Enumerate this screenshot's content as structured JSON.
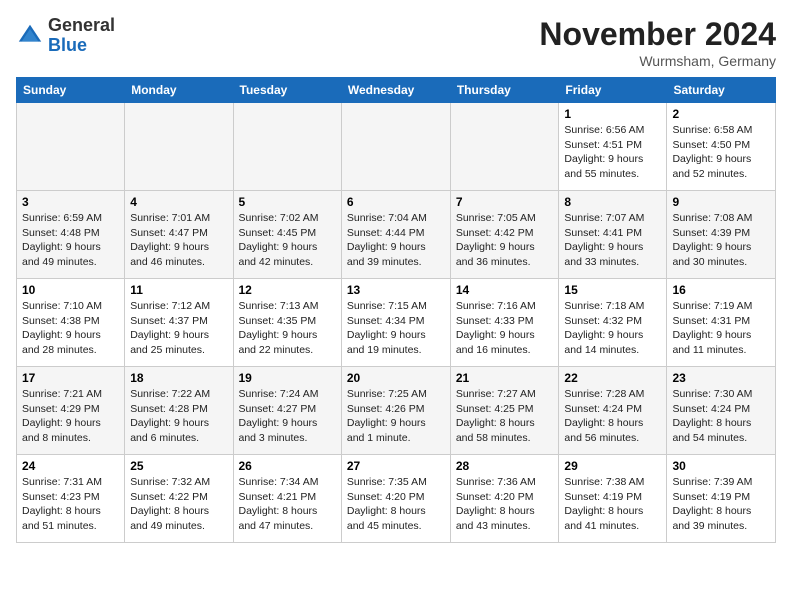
{
  "header": {
    "logo_general": "General",
    "logo_blue": "Blue",
    "month_title": "November 2024",
    "location": "Wurmsham, Germany"
  },
  "weekdays": [
    "Sunday",
    "Monday",
    "Tuesday",
    "Wednesday",
    "Thursday",
    "Friday",
    "Saturday"
  ],
  "weeks": [
    [
      {
        "day": "",
        "info": ""
      },
      {
        "day": "",
        "info": ""
      },
      {
        "day": "",
        "info": ""
      },
      {
        "day": "",
        "info": ""
      },
      {
        "day": "",
        "info": ""
      },
      {
        "day": "1",
        "info": "Sunrise: 6:56 AM\nSunset: 4:51 PM\nDaylight: 9 hours\nand 55 minutes."
      },
      {
        "day": "2",
        "info": "Sunrise: 6:58 AM\nSunset: 4:50 PM\nDaylight: 9 hours\nand 52 minutes."
      }
    ],
    [
      {
        "day": "3",
        "info": "Sunrise: 6:59 AM\nSunset: 4:48 PM\nDaylight: 9 hours\nand 49 minutes."
      },
      {
        "day": "4",
        "info": "Sunrise: 7:01 AM\nSunset: 4:47 PM\nDaylight: 9 hours\nand 46 minutes."
      },
      {
        "day": "5",
        "info": "Sunrise: 7:02 AM\nSunset: 4:45 PM\nDaylight: 9 hours\nand 42 minutes."
      },
      {
        "day": "6",
        "info": "Sunrise: 7:04 AM\nSunset: 4:44 PM\nDaylight: 9 hours\nand 39 minutes."
      },
      {
        "day": "7",
        "info": "Sunrise: 7:05 AM\nSunset: 4:42 PM\nDaylight: 9 hours\nand 36 minutes."
      },
      {
        "day": "8",
        "info": "Sunrise: 7:07 AM\nSunset: 4:41 PM\nDaylight: 9 hours\nand 33 minutes."
      },
      {
        "day": "9",
        "info": "Sunrise: 7:08 AM\nSunset: 4:39 PM\nDaylight: 9 hours\nand 30 minutes."
      }
    ],
    [
      {
        "day": "10",
        "info": "Sunrise: 7:10 AM\nSunset: 4:38 PM\nDaylight: 9 hours\nand 28 minutes."
      },
      {
        "day": "11",
        "info": "Sunrise: 7:12 AM\nSunset: 4:37 PM\nDaylight: 9 hours\nand 25 minutes."
      },
      {
        "day": "12",
        "info": "Sunrise: 7:13 AM\nSunset: 4:35 PM\nDaylight: 9 hours\nand 22 minutes."
      },
      {
        "day": "13",
        "info": "Sunrise: 7:15 AM\nSunset: 4:34 PM\nDaylight: 9 hours\nand 19 minutes."
      },
      {
        "day": "14",
        "info": "Sunrise: 7:16 AM\nSunset: 4:33 PM\nDaylight: 9 hours\nand 16 minutes."
      },
      {
        "day": "15",
        "info": "Sunrise: 7:18 AM\nSunset: 4:32 PM\nDaylight: 9 hours\nand 14 minutes."
      },
      {
        "day": "16",
        "info": "Sunrise: 7:19 AM\nSunset: 4:31 PM\nDaylight: 9 hours\nand 11 minutes."
      }
    ],
    [
      {
        "day": "17",
        "info": "Sunrise: 7:21 AM\nSunset: 4:29 PM\nDaylight: 9 hours\nand 8 minutes."
      },
      {
        "day": "18",
        "info": "Sunrise: 7:22 AM\nSunset: 4:28 PM\nDaylight: 9 hours\nand 6 minutes."
      },
      {
        "day": "19",
        "info": "Sunrise: 7:24 AM\nSunset: 4:27 PM\nDaylight: 9 hours\nand 3 minutes."
      },
      {
        "day": "20",
        "info": "Sunrise: 7:25 AM\nSunset: 4:26 PM\nDaylight: 9 hours\nand 1 minute."
      },
      {
        "day": "21",
        "info": "Sunrise: 7:27 AM\nSunset: 4:25 PM\nDaylight: 8 hours\nand 58 minutes."
      },
      {
        "day": "22",
        "info": "Sunrise: 7:28 AM\nSunset: 4:24 PM\nDaylight: 8 hours\nand 56 minutes."
      },
      {
        "day": "23",
        "info": "Sunrise: 7:30 AM\nSunset: 4:24 PM\nDaylight: 8 hours\nand 54 minutes."
      }
    ],
    [
      {
        "day": "24",
        "info": "Sunrise: 7:31 AM\nSunset: 4:23 PM\nDaylight: 8 hours\nand 51 minutes."
      },
      {
        "day": "25",
        "info": "Sunrise: 7:32 AM\nSunset: 4:22 PM\nDaylight: 8 hours\nand 49 minutes."
      },
      {
        "day": "26",
        "info": "Sunrise: 7:34 AM\nSunset: 4:21 PM\nDaylight: 8 hours\nand 47 minutes."
      },
      {
        "day": "27",
        "info": "Sunrise: 7:35 AM\nSunset: 4:20 PM\nDaylight: 8 hours\nand 45 minutes."
      },
      {
        "day": "28",
        "info": "Sunrise: 7:36 AM\nSunset: 4:20 PM\nDaylight: 8 hours\nand 43 minutes."
      },
      {
        "day": "29",
        "info": "Sunrise: 7:38 AM\nSunset: 4:19 PM\nDaylight: 8 hours\nand 41 minutes."
      },
      {
        "day": "30",
        "info": "Sunrise: 7:39 AM\nSunset: 4:19 PM\nDaylight: 8 hours\nand 39 minutes."
      }
    ]
  ]
}
